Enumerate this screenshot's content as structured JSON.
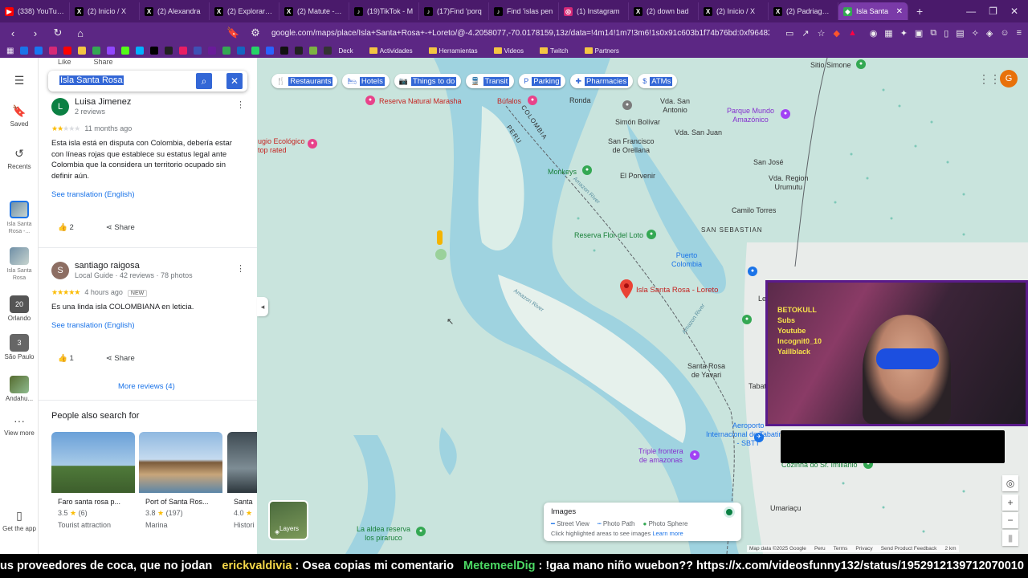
{
  "browser": {
    "tabs": [
      {
        "label": "(338) YouTube",
        "color": "#ff0000",
        "glyph": "▶"
      },
      {
        "label": "(2) Inicio / X",
        "color": "#000000",
        "glyph": "X"
      },
      {
        "label": "(2) Alexandra",
        "color": "#000000",
        "glyph": "X"
      },
      {
        "label": "(2) Explorar / X",
        "color": "#000000",
        "glyph": "X"
      },
      {
        "label": "(2) Matute - Bu",
        "color": "#000000",
        "glyph": "X"
      },
      {
        "label": "(19)TikTok - M",
        "color": "#000000",
        "glyph": "♪"
      },
      {
        "label": "(17)Find 'porq",
        "color": "#000000",
        "glyph": "♪"
      },
      {
        "label": "Find 'islas pen",
        "color": "#000000",
        "glyph": "♪"
      },
      {
        "label": "(1) Instagram",
        "color": "#d62976",
        "glyph": "◎"
      },
      {
        "label": "(2) down bad",
        "color": "#000000",
        "glyph": "X"
      },
      {
        "label": "(2) Inicio / X",
        "color": "#000000",
        "glyph": "X"
      },
      {
        "label": "(2) Padriago en",
        "color": "#000000",
        "glyph": "X"
      },
      {
        "label": "Isla Santa",
        "color": "#34a853",
        "glyph": "◆",
        "active": true
      }
    ],
    "url": "google.com/maps/place/Isla+Santa+Rosa+-+Loreto/@-4.2058077,-70.0178159,13z/data=!4m14!1m7!3m6!1s0x91c603b1f74b76bd:0xf96482cf...",
    "bookmarks": [
      "Deck",
      "Actividades",
      "Herramientas",
      "Videos",
      "Twitch",
      "Partners"
    ]
  },
  "rail": {
    "menu_icon": "☰",
    "items": [
      {
        "label": "Saved",
        "icon": "bookmark-icon",
        "glyph": "🔖"
      },
      {
        "label": "Recents",
        "icon": "history-icon",
        "glyph": "↺"
      }
    ],
    "recents": [
      {
        "label": "Isla Santa Rosa -..."
      },
      {
        "label": "Isla Santa Rosa"
      },
      {
        "label": "Orlando",
        "badge": "20"
      },
      {
        "label": "São Paulo",
        "badge": "3"
      },
      {
        "label": "Andahu..."
      }
    ],
    "view_more": "View more",
    "get_app": "Get the app"
  },
  "panel": {
    "top_actions": [
      "Like",
      "Share"
    ],
    "search": {
      "value": "Isla Santa Rosa"
    },
    "reviews": [
      {
        "initial": "L",
        "avatar_color": "#0b8043",
        "name": "Luisa Jimenez",
        "meta": "2 reviews",
        "rating": 2,
        "time": "11 months ago",
        "text": "Esta isla está en disputa con Colombia, debería estar con líneas rojas que establece su estatus legal ante Colombia que la considera un territorio ocupado sin definir aún.",
        "translate": "See translation (English)",
        "likes": "2",
        "share": "Share"
      },
      {
        "initial": "S",
        "avatar_color": "#8d6e63",
        "name": "santiago raigosa",
        "meta": "Local Guide · 42 reviews · 78 photos",
        "rating": 5,
        "time": "4 hours ago",
        "badge": "NEW",
        "text": "Es una linda isla COLOMBIANA en leticia.",
        "translate": "See translation (English)",
        "likes": "1",
        "share": "Share"
      }
    ],
    "more_reviews": "More reviews (4)",
    "people_also_search": {
      "title": "People also search for",
      "items": [
        {
          "name": "Faro santa rosa p...",
          "rating": "3.5",
          "count": "(6)",
          "type": "Tourist attraction"
        },
        {
          "name": "Port of Santa Ros...",
          "rating": "3.8",
          "count": "(197)",
          "type": "Marina"
        },
        {
          "name": "Santa",
          "rating": "4.0",
          "count": "",
          "type": "Histori"
        }
      ]
    }
  },
  "map": {
    "chips": [
      {
        "label": "Restaurants",
        "glyph": "🍴"
      },
      {
        "label": "Hotels",
        "glyph": "🛏"
      },
      {
        "label": "Things to do",
        "glyph": "📷"
      },
      {
        "label": "Transit",
        "glyph": "🚆"
      },
      {
        "label": "Parking",
        "glyph": "P"
      },
      {
        "label": "Pharmacies",
        "glyph": "✚"
      },
      {
        "label": "ATMs",
        "glyph": "$"
      }
    ],
    "avatar_initial": "G",
    "labels": {
      "reserva_marasha": "Reserva Natural Marasha",
      "bufalos": "Búfalos",
      "ronda": "Ronda",
      "vda_san_antonio": "Vda. San\nAntonio",
      "simon_bolivar": "Simón Bolívar",
      "vda_san_juan": "Vda. San Juan",
      "parque_mundo": "Parque Mundo\nAmazónico",
      "sitio_simone": "Sitio Simone",
      "san_francisco": "San Francisco\nde Orellana",
      "el_porvenir": "El Porvenir",
      "monkeys": "Monkeys",
      "san_jose": "San José",
      "vda_region": "Vda. Region\nUrumutu",
      "colombia": "COLOMBIA",
      "peru": "PERU",
      "ecologico": "ugio Ecológico\ntop rated",
      "camilo_torres": "Camilo Torres",
      "san_sebastian": "SAN SEBASTIAN",
      "reserva_flor": "Reserva Flor del Loto",
      "puerto_colombia": "Puerto\nColombia",
      "isla_santa_rosa": "Isla Santa Rosa - Loreto",
      "amazon_river": "Amazon River",
      "amazon_river2": "Amazon River",
      "amazon_river3": "Amazon River",
      "santa_rosa_yavari": "Santa Rosa\nde Yavari",
      "tabatinga": "Tabatinga",
      "aeroporto": "Aeroporto\nInternacional de Tabatinga\n- SBTT",
      "triple_frontera": "Triple frontera\nde amazonas",
      "cozinha": "Cozinha do Sr. Imilianio",
      "umariacu": "Umariaçu",
      "aldea": "La aldea reserva\nlos piraruco",
      "le": "Le"
    },
    "layers_label": "Layers",
    "images_card": {
      "title": "Images",
      "legend": [
        "Street View",
        "Photo Path",
        "Photo Sphere"
      ],
      "hint": "Click highlighted areas to see images",
      "link": "Learn more"
    },
    "footer": [
      "Map data ©2025 Google",
      "Peru",
      "Terms",
      "Privacy",
      "Send Product Feedback",
      "2 km"
    ]
  },
  "stream": {
    "overlay_text": [
      "BETOKULL",
      "Subs",
      "Youtube",
      "Incognit0_10",
      "Yaillblack"
    ],
    "ticker": {
      "lead": "us proveedores de coca, que no jodan",
      "user1": "erickvaldivia",
      "msg1": ": Osea copias mi comentario",
      "user2": "MetemeelDig",
      "msg2": ": !gaa mano niño wuebon?? https://x.com/videosfunny132/status/1952912139712070010"
    }
  },
  "colors": {
    "accent": "#1a73e8",
    "chrome": "#5c2784",
    "water": "#9fd3e0",
    "land": "#c9e4dd"
  }
}
